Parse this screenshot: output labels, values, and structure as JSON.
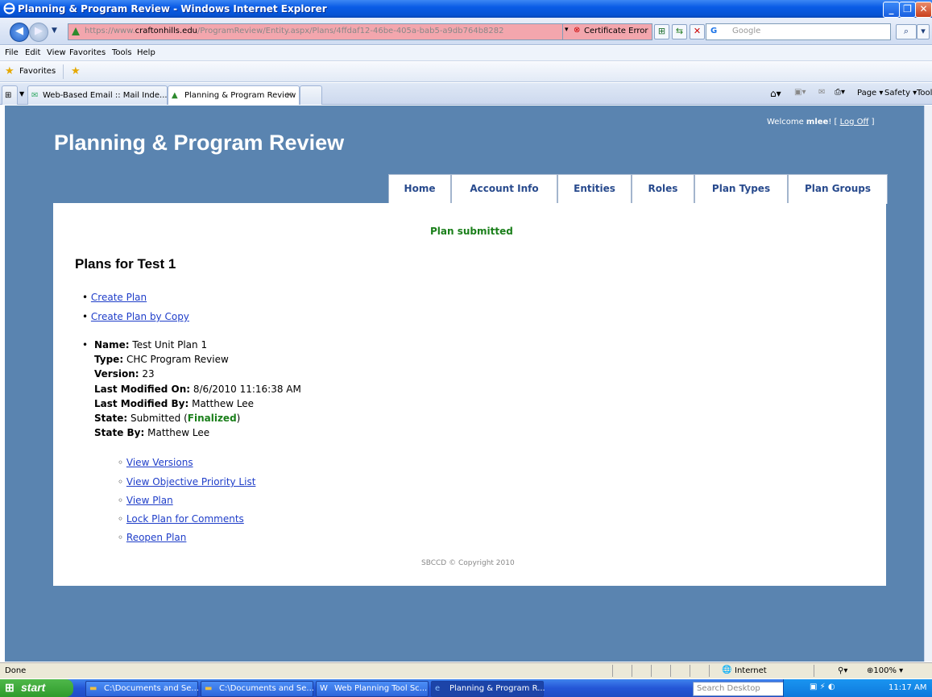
{
  "window": {
    "title": "Planning & Program Review - Windows Internet Explorer"
  },
  "browser": {
    "url_prefix": "https://www.",
    "url_domain": "craftonhills.edu",
    "url_rest": "/ProgramReview/Entity.aspx/Plans/4ffdaf12-46be-405a-bab5-a9db764b8282",
    "cert_error": "Certificate Error",
    "search_placeholder": "Google",
    "menu": [
      "File",
      "Edit",
      "View",
      "Favorites",
      "Tools",
      "Help"
    ],
    "favorites_label": "Favorites",
    "tabs": [
      {
        "label": "Web-Based Email :: Mail Inde..."
      },
      {
        "label": "Planning & Program Review"
      }
    ],
    "command_bar": {
      "page": "Page",
      "safety": "Safety",
      "tools": "Tools"
    }
  },
  "site": {
    "title": "Planning & Program Review",
    "welcome_prefix": "Welcome ",
    "username": "mlee",
    "welcome_suffix": "! [ ",
    "logoff": "Log Off",
    "welcome_end": " ]",
    "nav": [
      "Home",
      "Account Info",
      "Entities",
      "Roles",
      "Plan Types",
      "Plan Groups"
    ]
  },
  "main": {
    "message": "Plan submitted",
    "heading": "Plans for Test 1",
    "actions": [
      "Create Plan",
      "Create Plan by Copy"
    ],
    "plan": {
      "name_label": "Name:",
      "name": "Test Unit Plan 1",
      "type_label": "Type:",
      "type": "CHC Program Review",
      "version_label": "Version:",
      "version": "23",
      "modified_on_label": "Last Modified On:",
      "modified_on": "8/6/2010 11:16:38 AM",
      "modified_by_label": "Last Modified By:",
      "modified_by": "Matthew Lee",
      "state_label": "State:",
      "state": "Submitted",
      "state_final": "Finalized",
      "state_by_label": "State By:",
      "state_by": "Matthew Lee"
    },
    "plan_links": [
      "View Versions",
      "View Objective Priority List",
      "View Plan",
      "Lock Plan for Comments",
      "Reopen Plan"
    ],
    "copyright": "SBCCD © Copyright 2010"
  },
  "status": {
    "text": "Done",
    "zone": "Internet",
    "zoom": "100%"
  },
  "taskbar": {
    "start": "start",
    "tasks": [
      "C:\\Documents and Se...",
      "C:\\Documents and Se...",
      "Web Planning Tool Sc...",
      "Planning & Program R..."
    ],
    "search": "Search Desktop",
    "clock": "11:17 AM"
  }
}
